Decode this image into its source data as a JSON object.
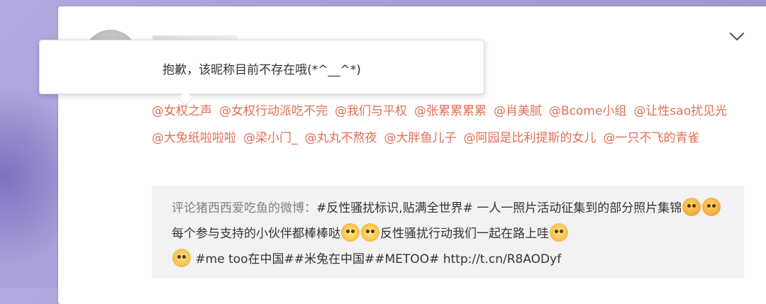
{
  "tooltip": {
    "text": "抱歉，该昵称目前不存在哦(*^__^*)"
  },
  "mentions": [
    "@女权之声",
    "@女权行动派吃不完",
    "@我们与平权",
    "@张累累累累",
    "@肖美腻",
    "@Bcome小组",
    "@让性sao扰见光",
    "@大兔纸啦啦啦",
    "@梁小门_",
    "@丸丸不熬夜",
    "@大胖鱼儿子",
    "@阿园是比利提斯的女儿",
    "@一只不飞的青雀"
  ],
  "repost": {
    "prefix": "评论猪西西爱吃鱼的微博：",
    "part1": "#反性骚扰标识,贴满全世界# 一人一照片活动征集到的部分照片集锦",
    "part2": "每个参与支持的小伙伴都棒棒哒",
    "part3": "反性骚扰行动我们一起在路上哇",
    "part4": " #me too在中国##米兔在中国##METOO# ",
    "link": "http://t.cn/R8AODyf"
  },
  "icons": {
    "expand": "chevron-down-icon",
    "emoji1": "drool-emoji-icon",
    "emoji2": "sun-emoji-icon",
    "emoji3": "hug-emoji-icon"
  },
  "colors": {
    "mention": "#e06f55",
    "repost_bg": "#f2f2f5",
    "page_bg": "#a89bd6"
  }
}
